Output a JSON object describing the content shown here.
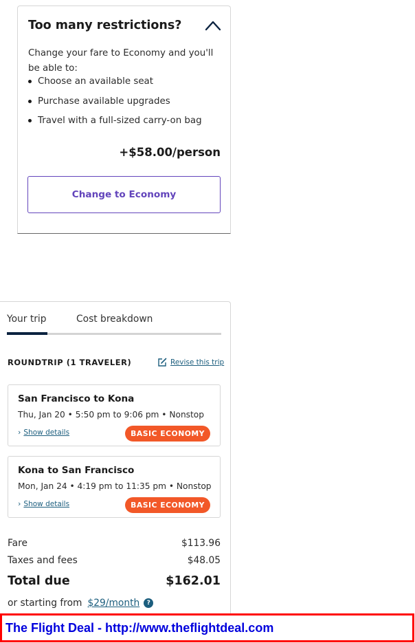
{
  "restrictions": {
    "title": "Too many restrictions?",
    "intro": "Change your fare to Economy and you'll be able to:",
    "benefits": [
      "Choose an available seat",
      "Purchase available upgrades",
      "Travel with a full-sized carry-on bag"
    ],
    "price": "+$58.00/person",
    "button_label": "Change to Economy"
  },
  "trip": {
    "tabs": [
      "Your trip",
      "Cost breakdown"
    ],
    "active_tab": "Your trip",
    "roundtrip_label": "ROUNDTRIP (1 TRAVELER)",
    "revise_label": "Revise this trip",
    "segments": [
      {
        "route": "San Francisco to Kona",
        "times": "Thu, Jan 20 • 5:50 pm to 9:06 pm • Nonstop",
        "details_label": "Show details",
        "badge": "BASIC ECONOMY"
      },
      {
        "route": "Kona to San Francisco",
        "times": "Mon, Jan 24 • 4:19 pm to 11:35 pm • Nonstop",
        "details_label": "Show details",
        "badge": "BASIC ECONOMY"
      }
    ],
    "costs": {
      "fare_label": "Fare",
      "fare_amount": "$113.96",
      "taxes_label": "Taxes and fees",
      "taxes_amount": "$48.05",
      "total_label": "Total due",
      "total_amount": "$162.01"
    },
    "financing": {
      "prefix": "or starting from",
      "monthly": "$29/month",
      "help_glyph": "?"
    }
  },
  "watermark": {
    "text": "The Flight Deal - http://www.theflightdeal.com"
  },
  "colors": {
    "accent_purple": "#6244bb",
    "link_teal": "#1c5e7e",
    "badge_orange": "#f25828",
    "tab_navy": "#0c2340",
    "watermark_red": "#ff0000",
    "watermark_blue": "#0000dd"
  },
  "icons": {
    "collapse": "chevron-up-icon",
    "revise": "edit-icon",
    "details": "chevron-right-icon",
    "help": "question-icon"
  }
}
